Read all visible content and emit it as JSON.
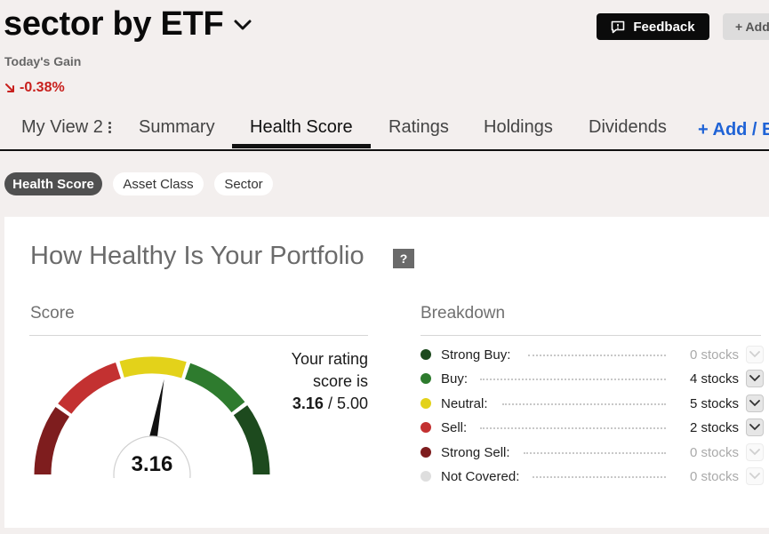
{
  "header": {
    "title": "sector by ETF",
    "feedback_label": "Feedback",
    "add_label": "+ Add",
    "gain_label": "Today's Gain",
    "gain_value": "-0.38%"
  },
  "tabs": [
    {
      "label": "My View 2",
      "active": false
    },
    {
      "label": "Summary",
      "active": false
    },
    {
      "label": "Health Score",
      "active": true
    },
    {
      "label": "Ratings",
      "active": false
    },
    {
      "label": "Holdings",
      "active": false
    },
    {
      "label": "Dividends",
      "active": false
    },
    {
      "label": "+ Add / E",
      "active": false
    }
  ],
  "pills": [
    {
      "label": "Health Score",
      "active": true
    },
    {
      "label": "Asset Class",
      "active": false
    },
    {
      "label": "Sector",
      "active": false
    }
  ],
  "card": {
    "title": "How Healthy Is Your Portfolio",
    "help": "?",
    "score_label": "Score",
    "breakdown_label": "Breakdown",
    "rating_line1": "Your rating",
    "rating_line2": "score is",
    "rating_score": "3.16",
    "rating_max": "/ 5.00",
    "gauge_value": "3.16",
    "gauge_score": 3.16,
    "gauge_min": 1,
    "gauge_max": 5
  },
  "breakdown": [
    {
      "label": "Strong Buy:",
      "count": "0 stocks",
      "color": "#1d4a1e",
      "has": false
    },
    {
      "label": "Buy:",
      "count": "4 stocks",
      "color": "#2e7b2e",
      "has": true
    },
    {
      "label": "Neutral:",
      "count": "5 stocks",
      "color": "#e3d21a",
      "has": true
    },
    {
      "label": "Sell:",
      "count": "2 stocks",
      "color": "#c33131",
      "has": true
    },
    {
      "label": "Strong Sell:",
      "count": "0 stocks",
      "color": "#7e1d1e",
      "has": false
    },
    {
      "label": "Not Covered:",
      "count": "0 stocks",
      "color": "#dedede",
      "has": false
    }
  ],
  "colors": {
    "strong_sell": "#7e1d1e",
    "sell": "#c33131",
    "neutral": "#e3d21a",
    "buy": "#2e7b2e",
    "strong_buy": "#1d4a1e",
    "negative": "#c8201d",
    "link": "#1f63d6"
  },
  "icons": {
    "title_chevron": "chevron-down-icon",
    "feedback": "feedback-icon",
    "gain_arrow": "arrow-down-right-icon",
    "help": "question-icon",
    "row_chevron": "chevron-down-icon"
  }
}
